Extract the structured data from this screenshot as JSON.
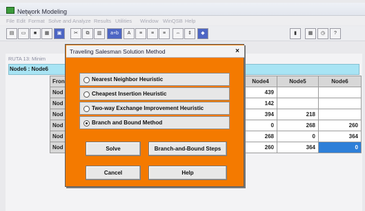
{
  "app": {
    "title": "Network Modeling"
  },
  "menu": [
    "File",
    "Edit",
    "Format",
    "Solve and Analyze",
    "Results",
    "Utilities",
    "Window",
    "WinQSB",
    "Help"
  ],
  "toolbar": {
    "net_label": "a+b",
    "font_label": "A"
  },
  "document": {
    "title": "RUTA 13: Minim",
    "cell_ref": "Node6 : Node6"
  },
  "grid": {
    "row_header": "Fron",
    "columns": [
      "Node4",
      "Node5",
      "Node6"
    ],
    "rows": [
      {
        "label": "Nod",
        "values": [
          "439",
          "",
          ""
        ]
      },
      {
        "label": "Nod",
        "values": [
          "142",
          "",
          ""
        ]
      },
      {
        "label": "Nod",
        "values": [
          "394",
          "218",
          ""
        ]
      },
      {
        "label": "Nod",
        "values": [
          "0",
          "268",
          "260"
        ]
      },
      {
        "label": "Nod",
        "values": [
          "268",
          "0",
          "364"
        ]
      },
      {
        "label": "Nod",
        "values": [
          "260",
          "364",
          "0"
        ]
      }
    ]
  },
  "dialog": {
    "title": "Traveling Salesman Solution Method",
    "close_glyph": "×",
    "options": [
      {
        "label": "Nearest Neighbor Heuristic",
        "checked": false
      },
      {
        "label": "Cheapest Insertion Heuristic",
        "checked": false
      },
      {
        "label": "Two-way Exchange Improvement Heuristic",
        "checked": false
      },
      {
        "label": "Branch and Bound Method",
        "checked": true
      }
    ],
    "buttons": {
      "solve": "Solve",
      "steps": "Branch-and-Bound Steps",
      "cancel": "Cancel",
      "help": "Help"
    }
  },
  "colors": {
    "dialog_bg": "#f47a00",
    "selection": "#a8e4f4",
    "highlight_cell": "#2e7fd8"
  }
}
